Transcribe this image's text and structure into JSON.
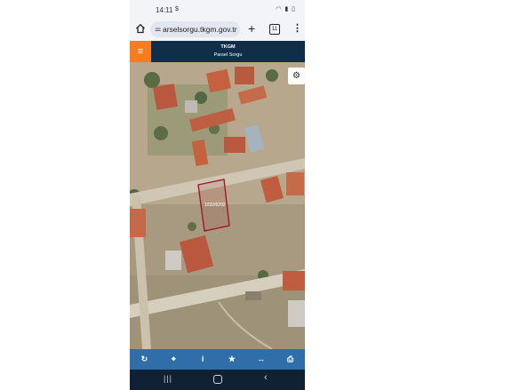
{
  "status_bar": {
    "time": "14:11",
    "extra": "$",
    "icons": "wifi-icon signal-icon battery-icon"
  },
  "browser": {
    "url": "arselsorgu.tkgm.gov.tr",
    "tab_count": "11",
    "icons": [
      "home-icon",
      "site-info-icon",
      "new-tab-icon",
      "tab-switcher-icon",
      "menu-dots-icon"
    ]
  },
  "app": {
    "title": "TKGM",
    "subtitle": "Parsel Sorgu",
    "accent_color": "#f57c21",
    "header_color": "#102e48",
    "menu_icon": "≡"
  },
  "map": {
    "parcel_label": "1032/6292",
    "parcel_color": "#a3172a",
    "settings_icon": "⚙"
  },
  "toolbar": {
    "color": "#2f6ea8",
    "items": [
      {
        "name": "refresh-icon",
        "glyph": "↻"
      },
      {
        "name": "locate-icon",
        "glyph": "⌖"
      },
      {
        "name": "info-icon",
        "glyph": "i"
      },
      {
        "name": "star-icon",
        "glyph": "★"
      },
      {
        "name": "measure-icon",
        "glyph": "↔"
      },
      {
        "name": "print-icon",
        "glyph": "⎙"
      }
    ]
  },
  "navigation": {
    "recent": "|||",
    "back": "‹"
  }
}
